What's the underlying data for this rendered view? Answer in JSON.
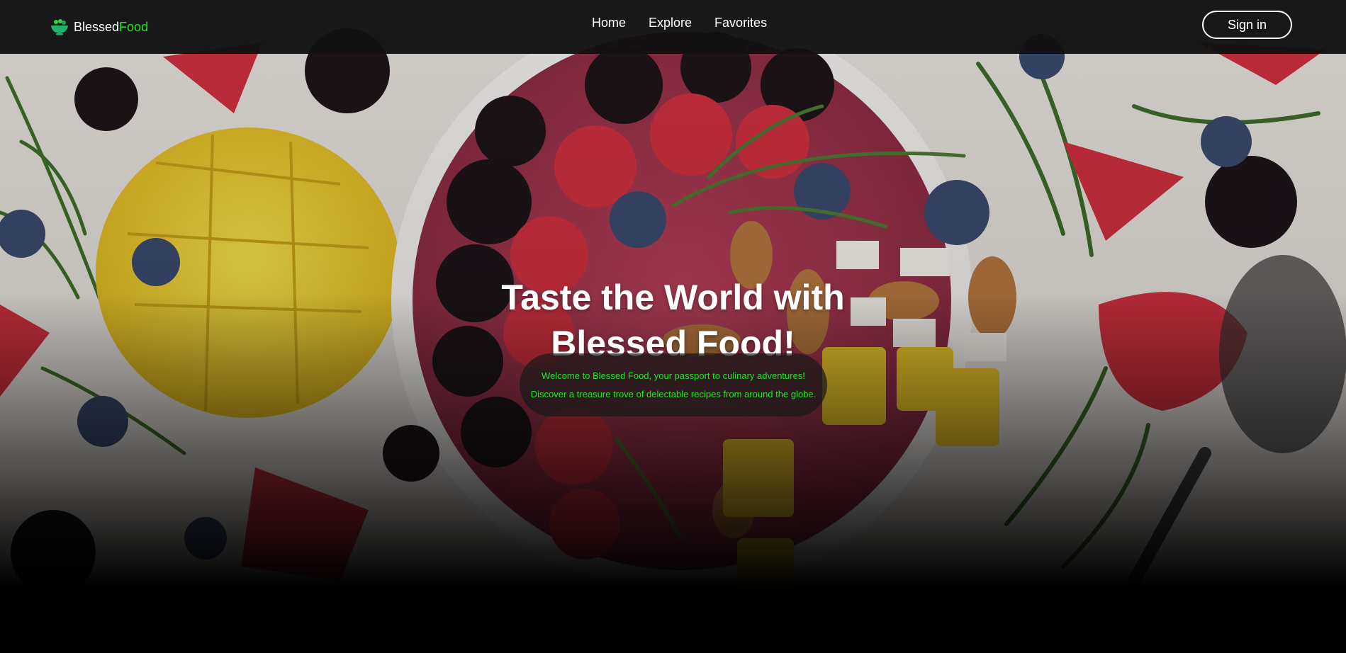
{
  "brand": {
    "name_part1": "Blessed",
    "name_part2": "Food",
    "accent_color": "#22e622",
    "logo_icon": "food-bowl-icon"
  },
  "nav": {
    "items": [
      {
        "label": "Home"
      },
      {
        "label": "Explore"
      },
      {
        "label": "Favorites"
      }
    ]
  },
  "auth": {
    "signin_label": "Sign in"
  },
  "hero": {
    "background": "smoothie-bowl-with-berries-photo",
    "headline_line1": "Taste the World with",
    "headline_line2": "Blessed Food!",
    "welcome_line1": "Welcome to Blessed Food, your passport to culinary adventures!",
    "welcome_line2": "Discover a treasure trove of delectable recipes from around the globe."
  }
}
